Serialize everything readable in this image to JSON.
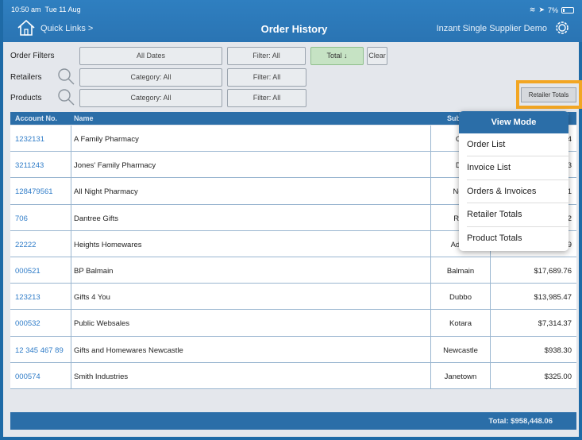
{
  "status": {
    "time": "10:50 am",
    "date": "Tue 11 Aug",
    "battery": "7%"
  },
  "header": {
    "quick_links": "Quick Links >",
    "title": "Order History",
    "supplier": "Inzant Single Supplier Demo"
  },
  "filters": {
    "order_label": "Order Filters",
    "retailers_label": "Retailers",
    "products_label": "Products",
    "all_dates": "All Dates",
    "filter_all": "Filter: All",
    "total_sort": "Total ↓",
    "clear": "Clear",
    "category_all": "Category: All",
    "retailer_totals": "Retailer Totals"
  },
  "table": {
    "headers": {
      "account": "Account No.",
      "name": "Name",
      "sub": "Sub"
    },
    "rows": [
      {
        "account": "1232131",
        "name": "A Family Pharmacy",
        "sub": "Co",
        "total": "4"
      },
      {
        "account": "3211243",
        "name": "Jones' Family Pharmacy",
        "sub": "Du",
        "total": "3"
      },
      {
        "account": "128479561",
        "name": "All Night Pharmacy",
        "sub": "New",
        "total": "1"
      },
      {
        "account": "706",
        "name": "Dantree Gifts",
        "sub": "Ran",
        "total": "2"
      },
      {
        "account": "22222",
        "name": "Heights Homewares",
        "sub": "Adam",
        "total": "9"
      },
      {
        "account": "000521",
        "name": "BP Balmain",
        "sub": "Balmain",
        "total": "$17,689.76"
      },
      {
        "account": "123213",
        "name": "Gifts 4 You",
        "sub": "Dubbo",
        "total": "$13,985.47"
      },
      {
        "account": "000532",
        "name": "Public Websales",
        "sub": "Kotara",
        "total": "$7,314.37"
      },
      {
        "account": "12 345 467 89",
        "name": "Gifts and Homewares Newcastle",
        "sub": "Newcastle",
        "total": "$938.30"
      },
      {
        "account": "000574",
        "name": "Smith Industries",
        "sub": "Janetown",
        "total": "$325.00"
      }
    ]
  },
  "footer": {
    "total": "Total: $958,448.06"
  },
  "popup": {
    "title": "View Mode",
    "items": [
      "Order List",
      "Invoice List",
      "Orders & Invoices",
      "Retailer Totals",
      "Product Totals"
    ]
  },
  "colors": {
    "header": "#2f7fc0",
    "table_header": "#2b6ea8",
    "highlight": "#f2a623",
    "link": "#2f7cc8"
  }
}
